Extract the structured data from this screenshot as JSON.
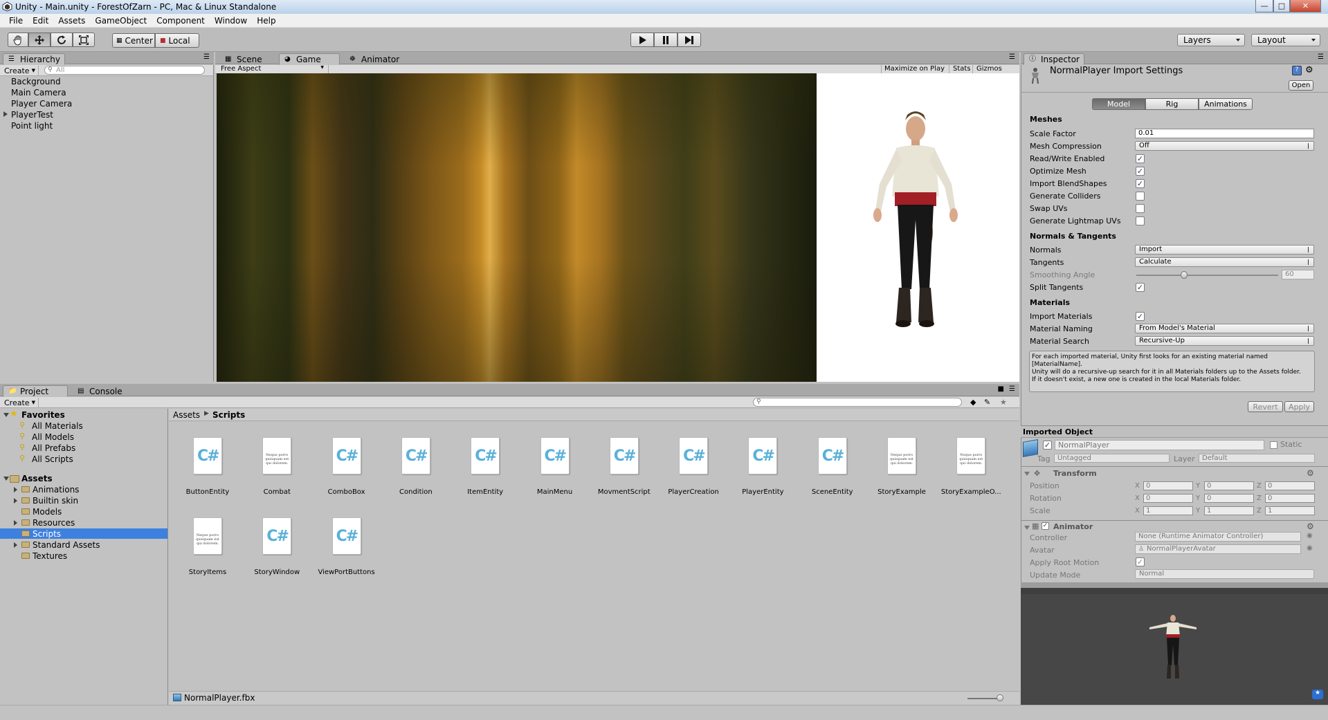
{
  "window": {
    "title": "Unity - Main.unity - ForestOfZarn - PC, Mac & Linux Standalone"
  },
  "menu": [
    "File",
    "Edit",
    "Assets",
    "GameObject",
    "Component",
    "Window",
    "Help"
  ],
  "toolbar": {
    "center_label": "Center",
    "local_label": "Local",
    "layers_label": "Layers",
    "layout_label": "Layout"
  },
  "hierarchy": {
    "tab": "Hierarchy",
    "create": "Create",
    "search_placeholder": "All",
    "items": [
      "Background",
      "Main Camera",
      "Player Camera",
      "PlayerTest",
      "Point light"
    ]
  },
  "view_tabs": {
    "scene": "Scene",
    "game": "Game",
    "animator": "Animator"
  },
  "game_bar": {
    "aspect": "Free Aspect",
    "maximize": "Maximize on Play",
    "stats": "Stats",
    "gizmos": "Gizmos"
  },
  "project": {
    "tab": "Project",
    "console_tab": "Console",
    "create": "Create",
    "favorites_label": "Favorites",
    "favorites": [
      "All Materials",
      "All Models",
      "All Prefabs",
      "All Scripts"
    ],
    "assets_label": "Assets",
    "folders": [
      "Animations",
      "Builtin skin",
      "Models",
      "Resources",
      "Scripts",
      "Standard Assets",
      "Textures"
    ],
    "breadcrumb_root": "Assets",
    "breadcrumb_current": "Scripts",
    "files": [
      {
        "name": "ButtonEntity",
        "kind": "cs"
      },
      {
        "name": "Combat",
        "kind": "txt"
      },
      {
        "name": "ComboBox",
        "kind": "cs"
      },
      {
        "name": "Condition",
        "kind": "cs"
      },
      {
        "name": "ItemEntity",
        "kind": "cs"
      },
      {
        "name": "MainMenu",
        "kind": "cs"
      },
      {
        "name": "MovmentScript",
        "kind": "cs"
      },
      {
        "name": "PlayerCreation",
        "kind": "cs"
      },
      {
        "name": "PlayerEntity",
        "kind": "cs"
      },
      {
        "name": "SceneEntity",
        "kind": "cs"
      },
      {
        "name": "StoryExample",
        "kind": "txt"
      },
      {
        "name": "StoryExampleO...",
        "kind": "txt"
      },
      {
        "name": "StoryItems",
        "kind": "txt"
      },
      {
        "name": "StoryWindow",
        "kind": "cs"
      },
      {
        "name": "ViewPortButtons",
        "kind": "cs"
      }
    ],
    "cs_glyph": "C#",
    "txt_glyph": "Neque porro quisquam est qui dolorem.",
    "status_file": "NormalPlayer.fbx"
  },
  "inspector": {
    "tab": "Inspector",
    "title": "NormalPlayer Import Settings",
    "open": "Open",
    "tabs": [
      "Model",
      "Rig",
      "Animations"
    ],
    "meshes_header": "Meshes",
    "scale_factor_label": "Scale Factor",
    "scale_factor": "0.01",
    "mesh_compression_label": "Mesh Compression",
    "mesh_compression": "Off",
    "rw_label": "Read/Write Enabled",
    "optimize_label": "Optimize Mesh",
    "blend_label": "Import BlendShapes",
    "colliders_label": "Generate Colliders",
    "swap_label": "Swap UVs",
    "lightmap_label": "Generate Lightmap UVs",
    "normals_header": "Normals & Tangents",
    "normals_label": "Normals",
    "normals": "Import",
    "tangents_label": "Tangents",
    "tangents": "Calculate",
    "smoothing_label": "Smoothing Angle",
    "smoothing": "60",
    "split_label": "Split Tangents",
    "materials_header": "Materials",
    "import_mat_label": "Import Materials",
    "naming_label": "Material Naming",
    "naming": "From Model's Material",
    "search_label": "Material Search",
    "search": "Recursive-Up",
    "help_text": "For each imported material, Unity first looks for an existing material named [MaterialName].\nUnity will do a recursive-up search for it in all Materials folders up to the Assets folder.\nIf it doesn't exist, a new one is created in the local Materials folder.",
    "revert": "Revert",
    "apply": "Apply",
    "imported_header": "Imported Object",
    "object_name": "NormalPlayer",
    "static_label": "Static",
    "tag_label": "Tag",
    "tag": "Untagged",
    "layer_label": "Layer",
    "layer": "Default",
    "transform_header": "Transform",
    "position_label": "Position",
    "rotation_label": "Rotation",
    "scale_label": "Scale",
    "position": [
      "0",
      "0",
      "0"
    ],
    "rotation": [
      "0",
      "0",
      "0"
    ],
    "scale": [
      "1",
      "1",
      "1"
    ],
    "x": "X",
    "y": "Y",
    "z": "Z",
    "animator_header": "Animator",
    "controller_label": "Controller",
    "controller": "None (Runtime Animator Controller)",
    "avatar_label": "Avatar",
    "avatar": "NormalPlayerAvatar",
    "root_motion_label": "Apply Root Motion",
    "update_label": "Update Mode",
    "update": "Normal"
  },
  "colors": {
    "selection": "#3d80df",
    "panel": "#c2c2c2",
    "tabstrip": "#a8a8a8"
  }
}
